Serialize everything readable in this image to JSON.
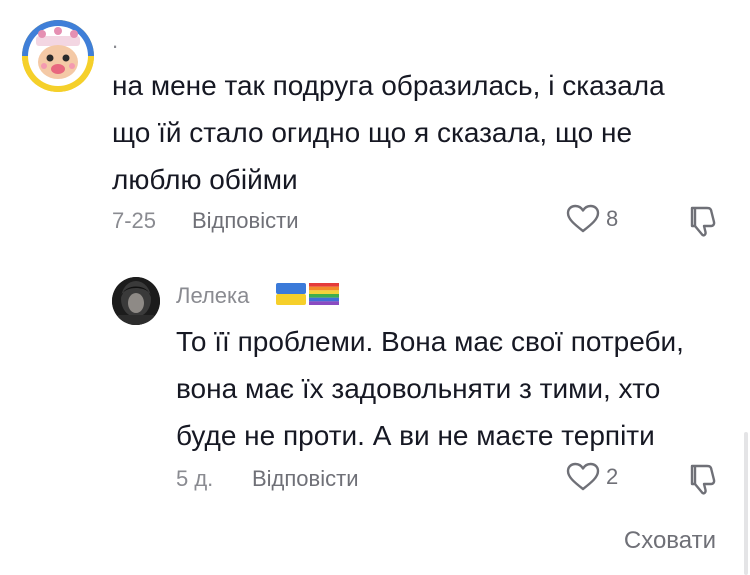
{
  "comment": {
    "username": ".",
    "lines": [
      "на мене так подруга образилась, і сказала",
      "що їй стало огидно що я сказала, що не",
      "люблю обійми"
    ],
    "date": "7-25",
    "reply_label": "Відповісти",
    "like_count": "8",
    "avatar_icon": "cartoon-character-avatar"
  },
  "reply": {
    "username": "Лелека",
    "flags": [
      "ukraine-flag",
      "rainbow-flag"
    ],
    "lines": [
      "То її проблеми. Вона має свої потреби,",
      "вона має їх задовольняти з тими, хто",
      "буде не проти. А ви не маєте терпіти"
    ],
    "date": "5 д.",
    "reply_label": "Відповісти",
    "like_count": "2",
    "avatar_icon": "dark-portrait-avatar"
  },
  "hide_label": "Сховати",
  "colors": {
    "text": "#161823",
    "muted": "#8a8b91",
    "action": "#6f7077"
  }
}
